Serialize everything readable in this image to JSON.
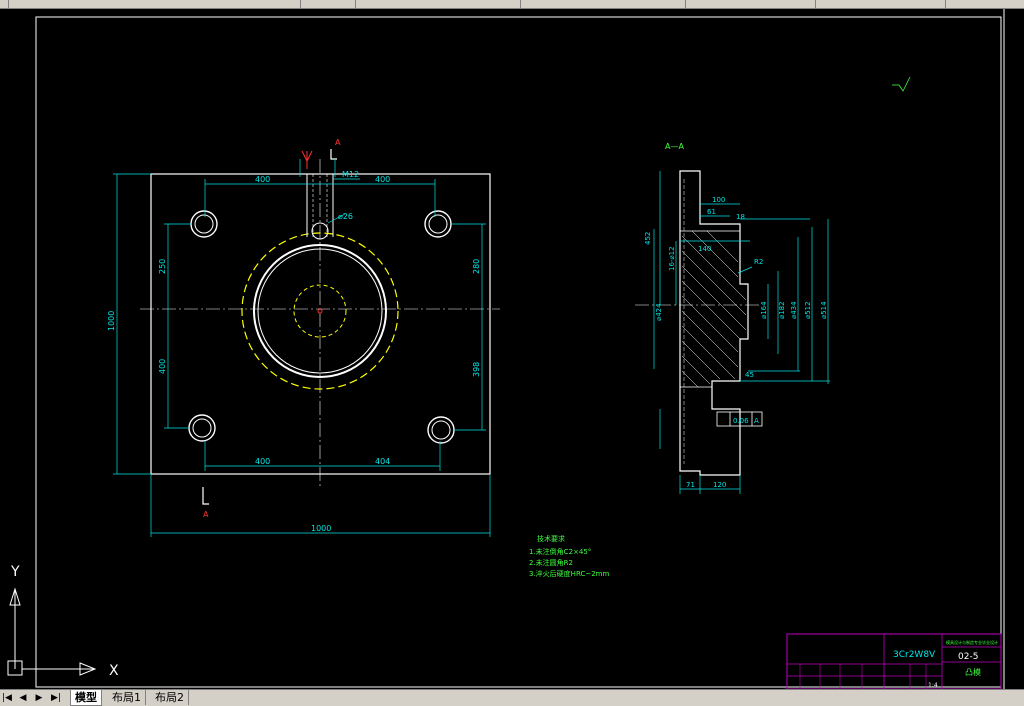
{
  "tabs": {
    "model": "模型",
    "layout1": "布局1",
    "layout2": "布局2"
  },
  "nav": {
    "first": "|◀",
    "prev": "◀",
    "next": "▶",
    "last": "▶|"
  },
  "ucs": {
    "x_label": "X",
    "y_label": "Y"
  },
  "plan_view": {
    "dim_top_left": "400",
    "dim_top_right": "400",
    "dim_bottom_left": "400",
    "dim_bottom_right": "404",
    "dim_overall_width": "1000",
    "dim_overall_height": "1000",
    "dim_left_upper": "250",
    "dim_left_lower": "400",
    "dim_right_upper": "280",
    "dim_right_lower": "398",
    "thread_label": "M12",
    "hole_dia_label": "⌀26",
    "section_mark_top": "A",
    "section_mark_bottom": "A"
  },
  "section_view": {
    "title": "A—A",
    "dim_100": "100",
    "dim_61": "61",
    "dim_18": "18",
    "dim_140": "140",
    "dim_r2": "R2",
    "dim_452": "452",
    "dim_16_412": "16-⌀12",
    "dim_d164": "⌀164",
    "dim_d182": "⌀182",
    "dim_d434": "⌀434",
    "dim_d512": "⌀512",
    "dim_d514": "⌀514",
    "dim_d424": "⌀424",
    "dim_45": "45",
    "dim_71": "71",
    "dim_120": "120",
    "tolerance_value": "0.06",
    "tolerance_datum": "A"
  },
  "notes": {
    "heading": "技术要求",
    "line1": "1.未注倒角C2×45°",
    "line2": "2.未注圆角R2",
    "line3": "3.淬火后硬度HRC~2mm"
  },
  "title_block": {
    "material": "3Cr2W8V",
    "drawing_no": "02-5",
    "part_name": "凸模",
    "company": "模具设计与制造专业毕业设计",
    "scale": "1:4"
  },
  "colors": {
    "background": "#000000",
    "dimension": "#00e5e5",
    "geometry": "#ffffff",
    "text_green": "#3fff3f",
    "hidden_yellow": "#ffff00",
    "border": "#c000c0",
    "red": "#ff3030"
  }
}
